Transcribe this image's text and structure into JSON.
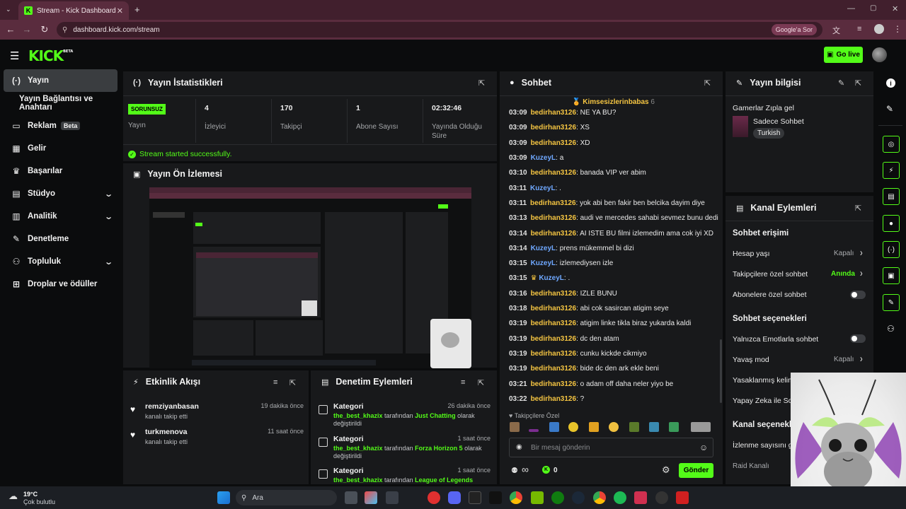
{
  "browser": {
    "tab_title": "Stream - Kick Dashboard",
    "url": "dashboard.kick.com/stream",
    "google_sor": "Google'a Sor"
  },
  "header": {
    "logo": "KICK",
    "logo_badge": "BETA",
    "go_live": "Go live"
  },
  "sidebar": {
    "items": [
      {
        "label": "Yayın",
        "icon": "broadcast-icon"
      },
      {
        "label": "Yayın Bağlantısı ve Anahtarı",
        "icon": ""
      },
      {
        "label": "Reklam",
        "icon": "ad-icon",
        "badge": "Beta"
      },
      {
        "label": "Gelir",
        "icon": "chart-icon"
      },
      {
        "label": "Başarılar",
        "icon": "trophy-icon"
      },
      {
        "label": "Stüdyo",
        "icon": "studio-icon"
      },
      {
        "label": "Analitik",
        "icon": "analytics-icon"
      },
      {
        "label": "Denetleme",
        "icon": "wrench-icon"
      },
      {
        "label": "Topluluk",
        "icon": "community-icon"
      },
      {
        "label": "Droplar ve ödüller",
        "icon": "drops-icon"
      }
    ]
  },
  "stats": {
    "title": "Yayın İstatistikleri",
    "status_badge": "SORUNSUZ",
    "status_label": "Yayın",
    "items": [
      {
        "value": "4",
        "label": "İzleyici"
      },
      {
        "value": "170",
        "label": "Takipçi"
      },
      {
        "value": "1",
        "label": "Abone Sayısı"
      },
      {
        "value": "02:32:46",
        "label": "Yayında Olduğu Süre"
      }
    ],
    "success": "Stream started successfully."
  },
  "preview": {
    "title": "Yayın Ön İzlemesi"
  },
  "activity": {
    "title": "Etkinlik Akışı",
    "items": [
      {
        "name": "remziyanbasan",
        "desc": "kanalı takip etti",
        "time": "19 dakika önce"
      },
      {
        "name": "turkmenova",
        "desc": "kanalı takip etti",
        "time": "11 saat önce"
      }
    ]
  },
  "moderation": {
    "title": "Denetim Eylemleri",
    "items": [
      {
        "title": "Kategori",
        "user": "the_best_khazix",
        "mid": "tarafından",
        "value": "Just Chatting",
        "end": "olarak değiştirildi",
        "time": "26 dakika önce"
      },
      {
        "title": "Kategori",
        "user": "the_best_khazix",
        "mid": "tarafından",
        "value": "Forza Horizon 5",
        "end": "olarak değiştirildi",
        "time": "1 saat önce"
      },
      {
        "title": "Kategori",
        "user": "the_best_khazix",
        "mid": "tarafından",
        "value": "League of Legends",
        "end": "olarak",
        "time": "1 saat önce"
      }
    ]
  },
  "chat": {
    "title": "Sohbet",
    "pinned_user": "Kimsesizlerinbabas",
    "pinned_count": "6",
    "messages": [
      {
        "time": "03:09",
        "user": "bedirhan3126",
        "text": "NE YA BU?",
        "color": "#f5c542"
      },
      {
        "time": "03:09",
        "user": "bedirhan3126",
        "text": "XS",
        "color": "#f5c542"
      },
      {
        "time": "03:09",
        "user": "bedirhan3126",
        "text": "XD",
        "color": "#f5c542"
      },
      {
        "time": "03:09",
        "user": "KuzeyL",
        "text": "a",
        "color": "#6fa8ff"
      },
      {
        "time": "03:10",
        "user": "bedirhan3126",
        "text": "banada VIP ver abim",
        "color": "#f5c542"
      },
      {
        "time": "03:11",
        "user": "KuzeyL",
        "text": ".",
        "color": "#6fa8ff"
      },
      {
        "time": "03:11",
        "user": "bedirhan3126",
        "text": "yok abi ben fakir ben belcika dayim diye",
        "color": "#f5c542"
      },
      {
        "time": "03:13",
        "user": "bedirhan3126",
        "text": "audi ve mercedes sahabi sevmez bunu dedi",
        "color": "#f5c542"
      },
      {
        "time": "03:14",
        "user": "bedirhan3126",
        "text": "AI ISTE BU filmi izlemedim ama cok iyi XD",
        "color": "#f5c542"
      },
      {
        "time": "03:14",
        "user": "KuzeyL",
        "text": "prens mükemmel bi dizi",
        "color": "#6fa8ff"
      },
      {
        "time": "03:15",
        "user": "KuzeyL",
        "text": "izlemediysen izle",
        "color": "#6fa8ff"
      },
      {
        "time": "03:15",
        "user": "KuzeyL",
        "text": ".",
        "color": "#6fa8ff"
      },
      {
        "time": "03:16",
        "user": "bedirhan3126",
        "text": "IZLE BUNU",
        "color": "#f5c542"
      },
      {
        "time": "03:18",
        "user": "bedirhan3126",
        "text": "abi cok sasircan atigim seye",
        "color": "#f5c542"
      },
      {
        "time": "03:19",
        "user": "bedirhan3126",
        "text": "atigim linke tikla biraz yukarda kaldi",
        "color": "#f5c542"
      },
      {
        "time": "03:19",
        "user": "bedirhan3126",
        "text": "dc den atam",
        "color": "#f5c542"
      },
      {
        "time": "03:19",
        "user": "bedirhan3126",
        "text": "cunku kickde cikmiyo",
        "color": "#f5c542"
      },
      {
        "time": "03:19",
        "user": "bedirhan3126",
        "text": "bide dc den ark ekle beni",
        "color": "#f5c542"
      },
      {
        "time": "03:21",
        "user": "bedirhan3126",
        "text": "o adam off daha neler yiyo be",
        "color": "#f5c542"
      },
      {
        "time": "03:22",
        "user": "bedirhan3126",
        "text": "?",
        "color": "#f5c542"
      }
    ],
    "followers_only": "Takipçilere Özel",
    "input_placeholder": "Bir mesaj gönderin",
    "infinity": "∞",
    "points": "0",
    "send": "Gönder"
  },
  "stream_info": {
    "title": "Yayın bilgisi",
    "stream_title": "Gamerlar Zıpla gel",
    "category": "Sadece Sohbet",
    "tag": "Turkish"
  },
  "channel_actions": {
    "title": "Kanal Eylemleri",
    "chat_access": "Sohbet erişimi",
    "account_age": "Hesap yaşı",
    "account_age_value": "Kapalı",
    "followers_chat": "Takipçilere özel sohbet",
    "followers_chat_value": "Anında",
    "subs_chat": "Abonelere özel sohbet",
    "chat_options": "Sohbet seçenekleri",
    "emote_only": "Yalnızca Emotlarla sohbet",
    "slow_mode": "Yavaş mod",
    "slow_mode_value": "Kapalı",
    "banned_words": "Yasaklanmış kelime",
    "ai_chat": "Yapay Zeka ile Soh",
    "channel_options": "Kanal seçenekle",
    "view_count": "İzlenme sayısını gö",
    "raid": "Raid Kanalı"
  },
  "taskbar": {
    "weather_temp": "19°C",
    "weather_desc": "Çok bulutlu",
    "search": "Ara"
  }
}
